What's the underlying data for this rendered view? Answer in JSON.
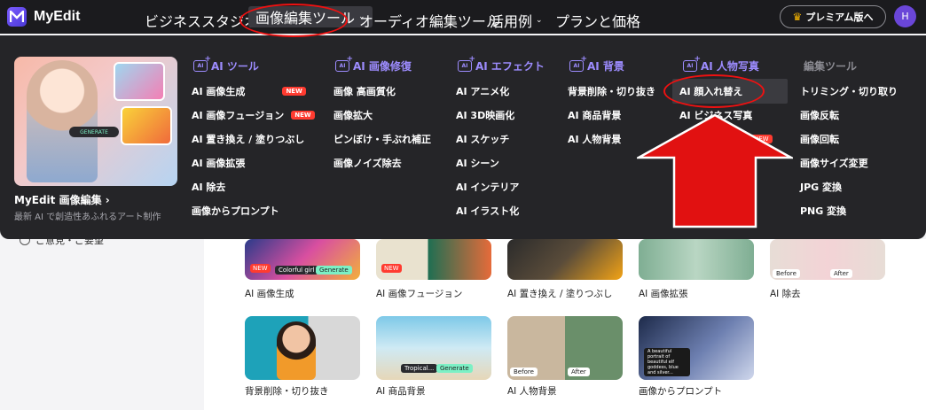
{
  "app": {
    "name": "MyEdit"
  },
  "nav": {
    "items": [
      {
        "label": "ビジネススタジオ",
        "has_dropdown": true
      },
      {
        "label": "画像編集ツール",
        "has_dropdown": true,
        "active": true
      },
      {
        "label": "オーディオ編集ツール",
        "has_dropdown": true
      },
      {
        "label": "活用例",
        "has_dropdown": true
      },
      {
        "label": "プランと価格",
        "has_dropdown": false
      }
    ],
    "premium_label": "プレミアム版へ",
    "avatar_initial": "H"
  },
  "promo": {
    "title": "MyEdit 画像編集 ›",
    "subtitle": "最新 AI で創造性あふれるアート制作",
    "generate_label": "GENERATE"
  },
  "menu": {
    "ai_tools": {
      "header": "AI ツール",
      "items": [
        {
          "label": "AI 画像生成",
          "badge": "NEW"
        },
        {
          "label": "AI 画像フュージョン",
          "badge": "NEW"
        },
        {
          "label": "AI 置き換え / 塗りつぶし"
        },
        {
          "label": "AI 画像拡張"
        },
        {
          "label": "AI 除去"
        },
        {
          "label": "画像からプロンプト"
        }
      ]
    },
    "ai_restore": {
      "header": "AI 画像修復",
      "items": [
        {
          "label": "画像 高画質化"
        },
        {
          "label": "画像拡大"
        },
        {
          "label": "ピンぼけ・手ぶれ補正"
        },
        {
          "label": "画像ノイズ除去"
        }
      ]
    },
    "ai_effects": {
      "header": "AI エフェクト",
      "items": [
        {
          "label": "AI アニメ化"
        },
        {
          "label": "AI 3D映画化"
        },
        {
          "label": "AI スケッチ"
        },
        {
          "label": "AI シーン"
        },
        {
          "label": "AI インテリア"
        },
        {
          "label": "AI イラスト化"
        }
      ]
    },
    "ai_background": {
      "header": "AI 背景",
      "items": [
        {
          "label": "背景削除・切り抜き"
        },
        {
          "label": "AI 商品背景"
        },
        {
          "label": "AI 人物背景"
        }
      ]
    },
    "ai_portrait": {
      "header": "AI 人物写真",
      "items": [
        {
          "label": "AI 顔入れ替え",
          "highlighted": true
        },
        {
          "label": "AI ビジネス写真"
        }
      ],
      "new_badge": "NEW"
    },
    "edit_tools": {
      "header": "編集ツール",
      "items": [
        {
          "label": "トリミング・切り取り"
        },
        {
          "label": "画像反転"
        },
        {
          "label": "画像回転"
        },
        {
          "label": "画像サイズ変更"
        },
        {
          "label": "JPG 変換"
        },
        {
          "label": "PNG 変換"
        }
      ]
    }
  },
  "sidebar": {
    "feedback_label": "ご意見・ご要望"
  },
  "gallery": {
    "row1": [
      {
        "caption": "AI 画像生成",
        "tag": "NEW",
        "chip_text": "Colorful girl",
        "chip_button": "Generate"
      },
      {
        "caption": "AI 画像フュージョン",
        "tag": "NEW"
      },
      {
        "caption": "AI 置き換え / 塗りつぶし"
      },
      {
        "caption": "AI 画像拡張"
      },
      {
        "caption": "AI 除去",
        "before": "Before",
        "after": "After"
      }
    ],
    "row2": [
      {
        "caption": "背景削除・切り抜き"
      },
      {
        "caption": "AI 商品背景",
        "chip_text": "Tropical...",
        "chip_button": "Generate"
      },
      {
        "caption": "AI 人物背景",
        "before": "Before",
        "after": "After"
      },
      {
        "caption": "画像からプロンプト",
        "prompt_text": "A beautiful portrait of beautiful elf goddess, blue and silver..."
      }
    ]
  },
  "colors": {
    "topbar": "#1b1b1e",
    "dropdown": "#252528",
    "accent_purple": "#9d8cff",
    "new_badge": "#ff3b30",
    "annotation_red": "#e11111"
  }
}
